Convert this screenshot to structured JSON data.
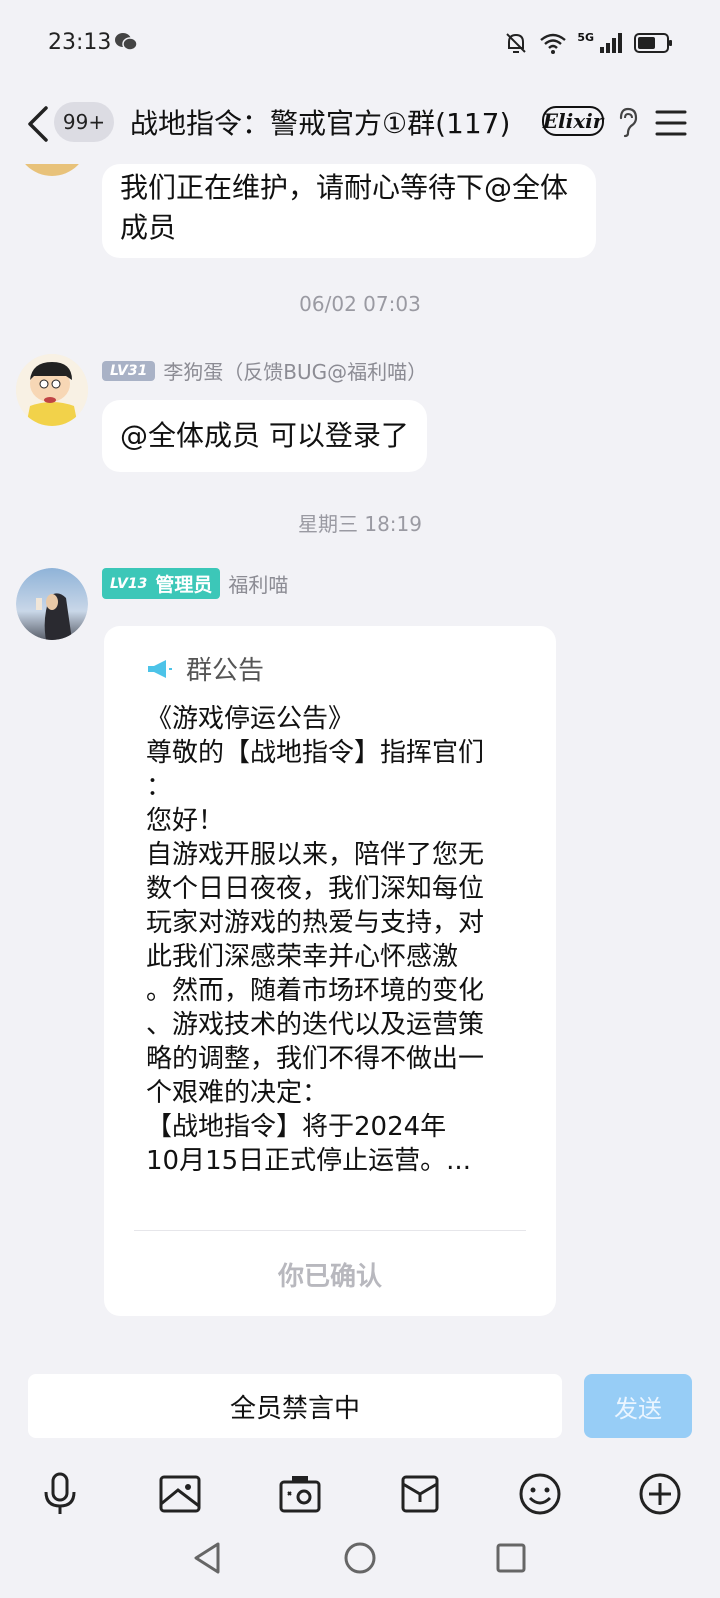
{
  "status_bar": {
    "time": "23:13",
    "network": "5G"
  },
  "header": {
    "unread_count": "99+",
    "title": "战地指令：警戒官方①群(117)",
    "elixir_label": "Elixir"
  },
  "messages": [
    {
      "text": "我们正在维护，请耐心等待下@全体成员"
    },
    {
      "timestamp": "06/02 07:03"
    },
    {
      "level": "LV31",
      "sender": "李狗蛋（反馈BUG@福利喵）",
      "text": "@全体成员 可以登录了"
    },
    {
      "timestamp": "星期三 18:19"
    },
    {
      "level": "LV13",
      "role": "管理员",
      "sender": "福利喵"
    }
  ],
  "notice": {
    "title": "群公告",
    "lines": [
      "《游戏停运公告》",
      "尊敬的【战地指令】指挥官们",
      "：",
      "您好！",
      "自游戏开服以来，陪伴了您无",
      "数个日日夜夜，我们深知每位",
      "玩家对游戏的热爱与支持，对",
      "此我们深感荣幸并心怀感激",
      "。然而，随着市场环境的变化",
      "、游戏技术的迭代以及运营策",
      "略的调整，我们不得不做出一",
      "个艰难的决定：",
      "【战地指令】将于2024年",
      "10月15日正式停止运营。..."
    ],
    "confirm": "你已确认"
  },
  "input": {
    "mute_text": "全员禁言中",
    "send_label": "发送"
  },
  "toolbar": [
    "mic-icon",
    "image-icon",
    "camera-icon",
    "folder-icon",
    "emoji-icon",
    "plus-icon"
  ],
  "colors": {
    "background": "#f2f2f6",
    "admin_badge": "#3cc7b8",
    "send_button": "#97cdf6",
    "level_badge": "#a9b2c6"
  }
}
